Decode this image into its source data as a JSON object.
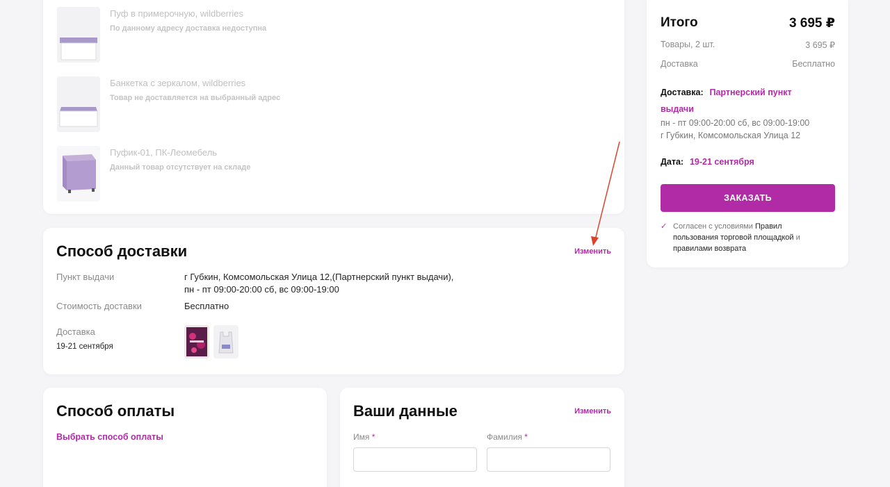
{
  "items": [
    {
      "title": "Пуф в примерочную, wildberries",
      "note": "По данному адресу доставка недоступна"
    },
    {
      "title": "Банкетка с зеркалом, wildberries",
      "note": "Товар не доставляется на выбранный адрес"
    },
    {
      "title": "Пуфик-01, ПК-Леомебель",
      "note": "Данный товар отсутствует на складе"
    }
  ],
  "delivery": {
    "title": "Способ доставки",
    "change": "Изменить",
    "pickup_label": "Пункт выдачи",
    "pickup_value_1": "г Губкин, Комсомольская Улица 12,(Партнерский пункт выдачи),",
    "pickup_value_2": "пн - пт 09:00-20:00 сб, вс 09:00-19:00",
    "cost_label": "Стоимость доставки",
    "cost_value": "Бесплатно",
    "date_label": "Доставка",
    "date_value": "19-21 сентября"
  },
  "payment": {
    "title": "Способ оплаты",
    "choose": "Выбрать способ оплаты"
  },
  "user": {
    "title": "Ваши данные",
    "change": "Изменить",
    "first_name_label": "Имя",
    "last_name_label": "Фамилия",
    "required_mark": "*"
  },
  "summary": {
    "total_label": "Итого",
    "total_value": "3 695 ₽",
    "goods_label": "Товары, 2 шт.",
    "goods_value": "3 695 ₽",
    "shipping_label": "Доставка",
    "shipping_value": "Бесплатно",
    "delivery_label": "Доставка:",
    "delivery_value_1": "Партнерский пункт",
    "delivery_value_2": "выдачи",
    "hours": "пн - пт 09:00-20:00 сб, вс 09:00-19:00",
    "address": "г Губкин, Комсомольская Улица 12",
    "date_label": "Дата:",
    "date_value": "19-21 сентября",
    "order_button": "ЗАКАЗАТЬ",
    "agree_prefix": "Согласен с условиями",
    "agree_link1": "Правил пользования торговой площадкой",
    "agree_mid": "и",
    "agree_link2": "правилами возврата"
  },
  "colors": {
    "accent": "#b12ba6",
    "annotation_arrow": "#d9452c"
  }
}
